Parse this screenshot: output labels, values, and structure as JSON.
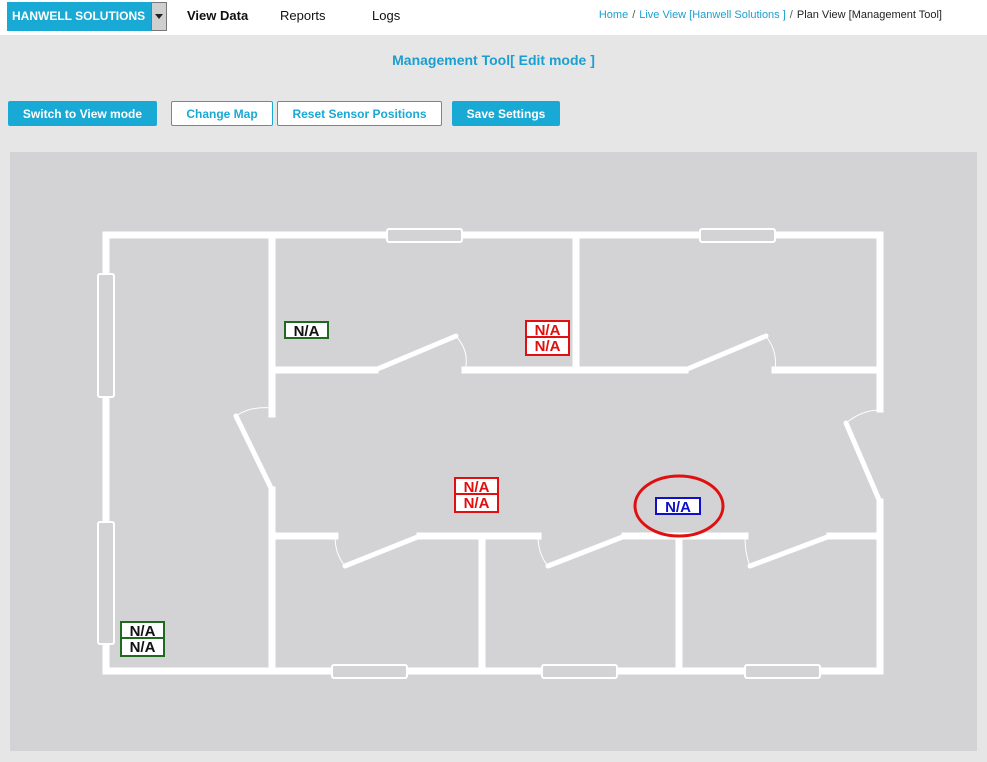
{
  "header": {
    "brand": "HANWELL SOLUTIONS",
    "nav": [
      "View Data",
      "Reports",
      "Logs"
    ],
    "breadcrumb": {
      "home": "Home",
      "live": "Live View [Hanwell Solutions ]",
      "current": "Plan View [Management Tool]"
    }
  },
  "page": {
    "title": "Management Tool[ Edit mode ]"
  },
  "toolbar": {
    "switch_label": "Switch to View mode",
    "change_map_label": "Change Map",
    "reset_label": "Reset Sensor Positions",
    "save_label": "Save Settings"
  },
  "sensors": {
    "room_top_left": [
      "N/A"
    ],
    "room_top_mid": [
      "N/A",
      "N/A"
    ],
    "corridor_mid": [
      "N/A",
      "N/A"
    ],
    "corridor_right": [
      "N/A"
    ],
    "room_bottom_left": [
      "N/A",
      "N/A"
    ]
  },
  "colors": {
    "accent": "#19a9d5",
    "sensor_ok": "#1f6a1f",
    "sensor_alarm": "#e01010",
    "sensor_selected": "#1010c8",
    "highlight_ring": "#e01010"
  }
}
